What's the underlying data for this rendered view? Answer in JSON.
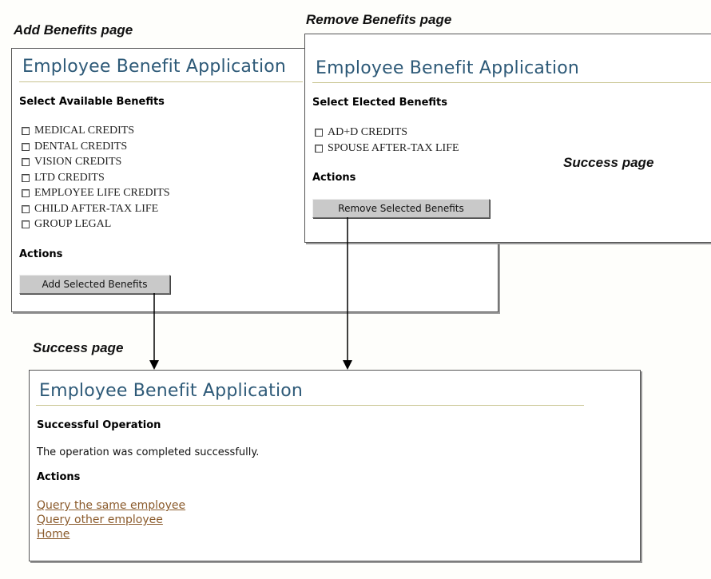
{
  "captions": {
    "add": "Add Benefits page",
    "remove": "Remove Benefits page",
    "success_right": "Success page",
    "success_bottom": "Success page"
  },
  "add_page": {
    "title": "Employee Benefit Application",
    "section": "Select Available Benefits",
    "benefits": [
      "MEDICAL CREDITS",
      "DENTAL CREDITS",
      "VISION CREDITS",
      "LTD CREDITS",
      "EMPLOYEE LIFE CREDITS",
      "CHILD AFTER-TAX LIFE",
      "GROUP LEGAL"
    ],
    "actions_label": "Actions",
    "button_label": "Add Selected Benefits"
  },
  "remove_page": {
    "title": "Employee Benefit Application",
    "section": "Select Elected Benefits",
    "benefits": [
      "AD+D CREDITS",
      "SPOUSE AFTER-TAX LIFE"
    ],
    "actions_label": "Actions",
    "button_label": "Remove Selected Benefits"
  },
  "success_page": {
    "title": "Employee Benefit Application",
    "section": "Successful Operation",
    "message": "The operation was completed successfully.",
    "actions_label": "Actions",
    "links": [
      "Query the same employee",
      "Query other employee",
      "Home"
    ]
  },
  "colors": {
    "title": "#2e5a78",
    "rule": "#c8c490",
    "button": "#c9c9c9",
    "link": "#8a5a2b"
  }
}
